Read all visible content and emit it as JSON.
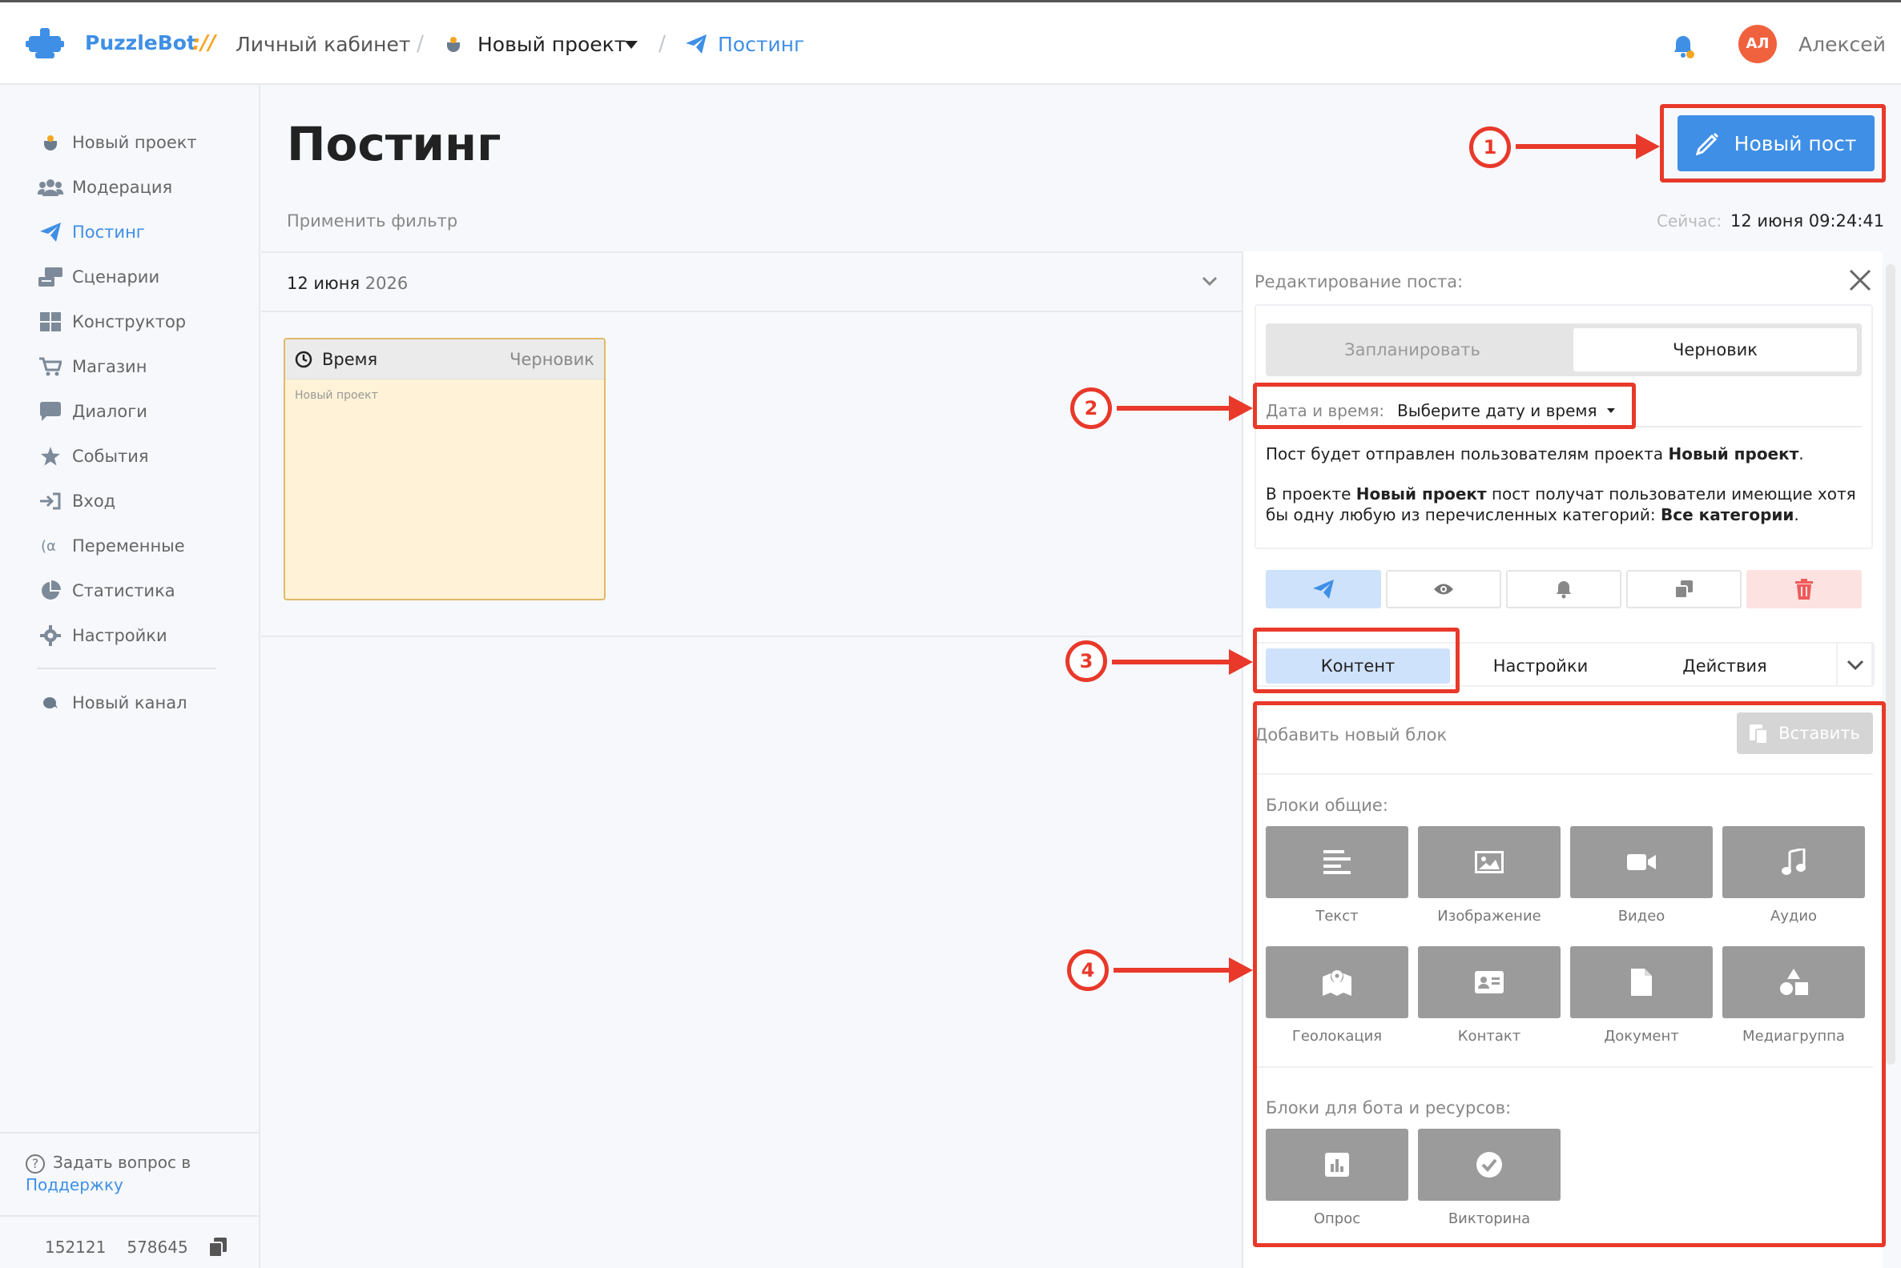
{
  "topbar": {
    "brand": "PuzzleBot",
    "brand_sep": "://",
    "cabinet": "Личный кабинет",
    "project": "Новый проект",
    "section": "Постинг",
    "user_initials": "АЛ",
    "user_name": "Алексей"
  },
  "sidebar": {
    "items": [
      {
        "label": "Новый проект",
        "icon": "project-icon"
      },
      {
        "label": "Модерация",
        "icon": "users-icon"
      },
      {
        "label": "Постинг",
        "icon": "paper-plane-icon",
        "active": true
      },
      {
        "label": "Сценарии",
        "icon": "scenarios-icon"
      },
      {
        "label": "Конструктор",
        "icon": "grid-icon"
      },
      {
        "label": "Магазин",
        "icon": "cart-icon"
      },
      {
        "label": "Диалоги",
        "icon": "chat-icon"
      },
      {
        "label": "События",
        "icon": "star-icon"
      },
      {
        "label": "Вход",
        "icon": "sign-in-icon"
      },
      {
        "label": "Переменные",
        "icon": "variable-icon"
      },
      {
        "label": "Статистика",
        "icon": "pie-chart-icon"
      },
      {
        "label": "Настройки",
        "icon": "gear-icon"
      }
    ],
    "channel": "Новый канал",
    "help_text": "Задать вопрос в",
    "help_link": "Поддержку",
    "id1": "152121",
    "id2": "578645"
  },
  "main": {
    "title": "Постинг",
    "filter": "Применить фильтр",
    "now_label": "Сейчас:",
    "now_value": "12 июня 09:24:41",
    "new_post": "Новый пост",
    "date_day": "12 июня",
    "date_year": "2026",
    "card": {
      "time": "Время",
      "status": "Черновик",
      "project": "Новый проект"
    }
  },
  "panel": {
    "title": "Редактирование поста:",
    "seg_schedule": "Запланировать",
    "seg_draft": "Черновик",
    "dt_label": "Дата и время:",
    "dt_value": "Выберите дату и время",
    "info1_pre": "Пост будет отправлен пользователям проекта ",
    "info1_bold": "Новый проект",
    "info1_post": ".",
    "info2_pre": "В проекте ",
    "info2_bold": "Новый проект",
    "info2_mid": " пост получат пользователи имеющие хотя бы одну любую из перечисленных категорий: ",
    "info2_bold2": "Все категории",
    "info2_post": ".",
    "tabs": [
      "Контент",
      "Настройки",
      "Действия"
    ],
    "add_block": "Добавить новый блок",
    "paste": "Вставить",
    "group_common": "Блоки общие:",
    "group_bot": "Блоки для бота и ресурсов:",
    "blocks_common": [
      "Текст",
      "Изображение",
      "Видео",
      "Аудио",
      "Геолокация",
      "Контакт",
      "Документ",
      "Медиагруппа"
    ],
    "blocks_bot": [
      "Опрос",
      "Викторина"
    ]
  },
  "annotations": [
    "1",
    "2",
    "3",
    "4"
  ],
  "colors": {
    "accent": "#3f8fe6",
    "annotation": "#e8392a",
    "draft_card": "#fff2d6",
    "tile": "#9b9b9b"
  }
}
